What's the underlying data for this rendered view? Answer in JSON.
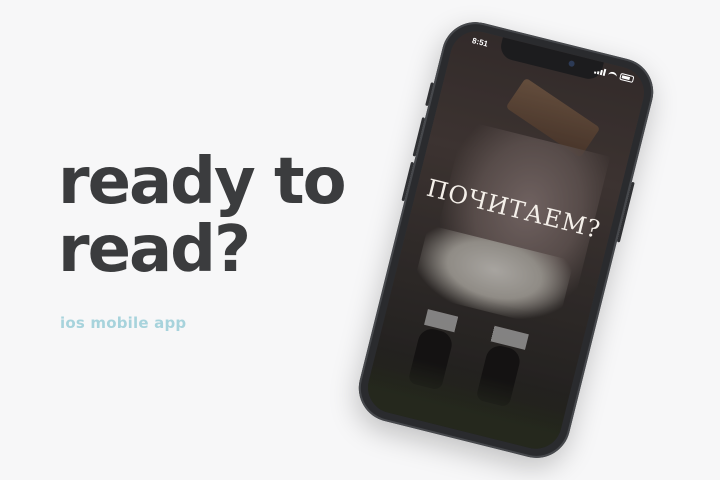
{
  "hero": {
    "headline_line1": "ready to",
    "headline_line2": "read?",
    "subtitle": "ios mobile app"
  },
  "phone": {
    "status_time": "8:51",
    "screen_title": "ПОЧИТАЕМ?"
  },
  "colors": {
    "background": "#f7f7f8",
    "headline": "#3b3c3e",
    "subtitle": "#a7d3dc",
    "phone_frame": "#2a2b2e"
  },
  "icons": [
    "signal-icon",
    "wifi-icon",
    "battery-icon"
  ]
}
